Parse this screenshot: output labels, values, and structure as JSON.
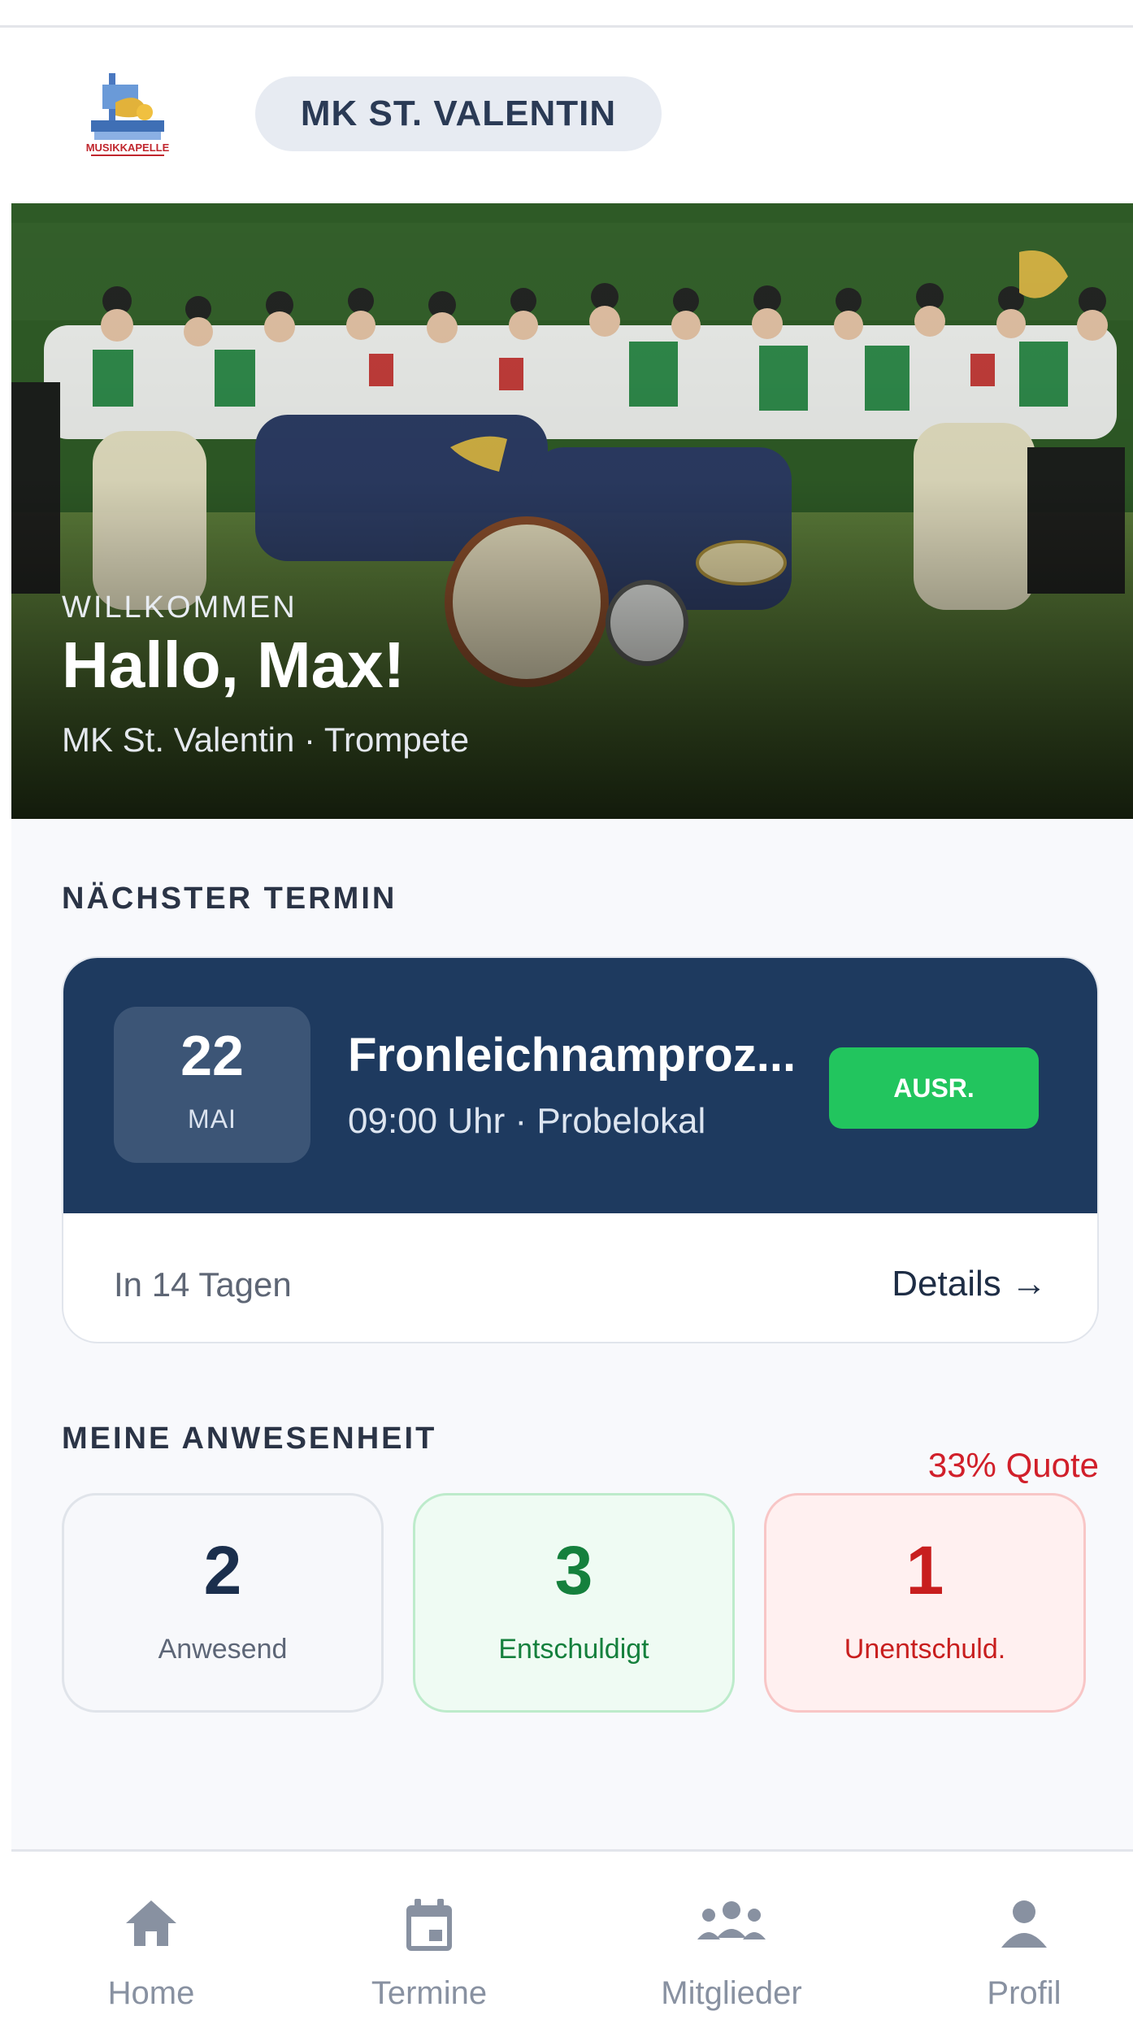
{
  "header": {
    "club_name": "MK ST. VALENTIN",
    "logo_text": "MUSIKKAPELLE"
  },
  "hero": {
    "kicker": "WILLKOMMEN",
    "title": "Hallo, Max!",
    "subtitle": "MK St. Valentin · Trompete"
  },
  "next_event": {
    "section_title": "NÄCHSTER TERMIN",
    "day": "22",
    "month": "MAI",
    "title": "Fronleichnamproz...",
    "meta": "09:00 Uhr · Probelokal",
    "status": "AUSR.",
    "countdown": "In 14 Tagen",
    "details_link": "Details →"
  },
  "attendance": {
    "section_title": "MEINE ANWESENHEIT",
    "quote": "33% Quote",
    "stats": [
      {
        "value": "2",
        "label": "Anwesend"
      },
      {
        "value": "3",
        "label": "Entschuldigt"
      },
      {
        "value": "1",
        "label": "Unentschuld."
      }
    ]
  },
  "nav": {
    "items": [
      {
        "label": "Home",
        "icon": "home-icon"
      },
      {
        "label": "Termine",
        "icon": "calendar-icon"
      },
      {
        "label": "Mitglieder",
        "icon": "members-icon"
      },
      {
        "label": "Profil",
        "icon": "profile-icon"
      }
    ]
  },
  "colors": {
    "primary": "#1e3a5f",
    "success": "#22c55e",
    "danger": "#d11f2a"
  }
}
